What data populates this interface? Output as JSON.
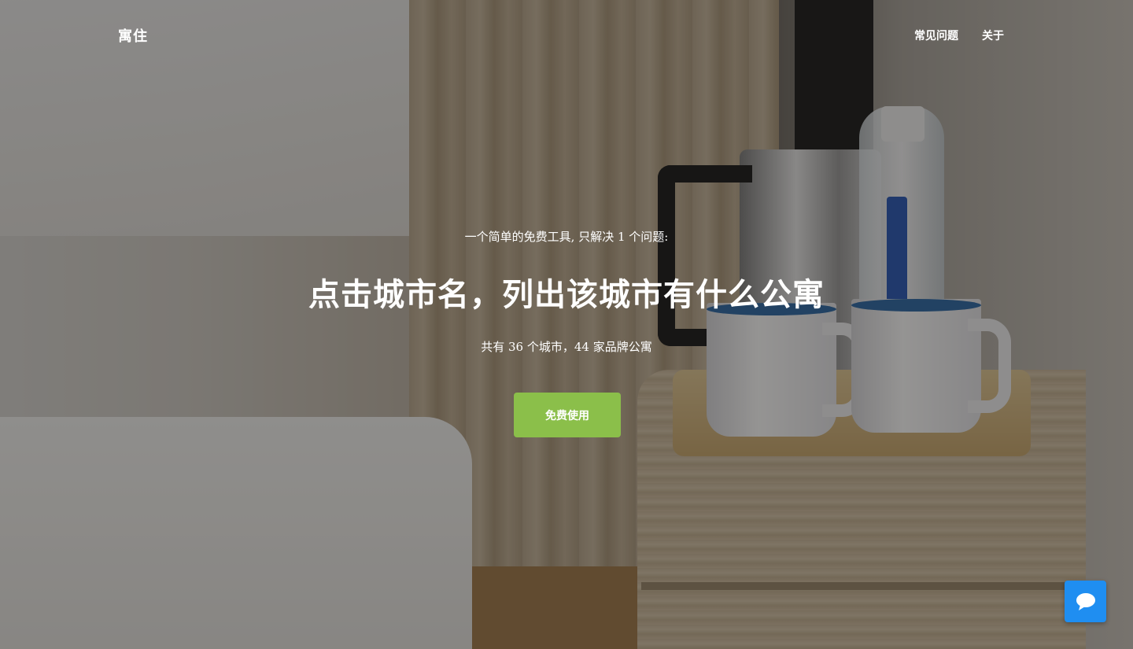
{
  "header": {
    "logo": "寓住",
    "nav": [
      {
        "label": "常见问题"
      },
      {
        "label": "关于"
      }
    ]
  },
  "hero": {
    "tagline": "一个简单的免费工具, 只解决 1 个问题:",
    "headline": "点击城市名，列出该城市有什么公寓",
    "stats": "共有 36 个城市，44 家品牌公寓",
    "cta_label": "免费使用",
    "cta_color": "#8bbf4a"
  },
  "chat_widget": {
    "icon": "chat-bubble-icon",
    "color": "#1f8ef1"
  }
}
